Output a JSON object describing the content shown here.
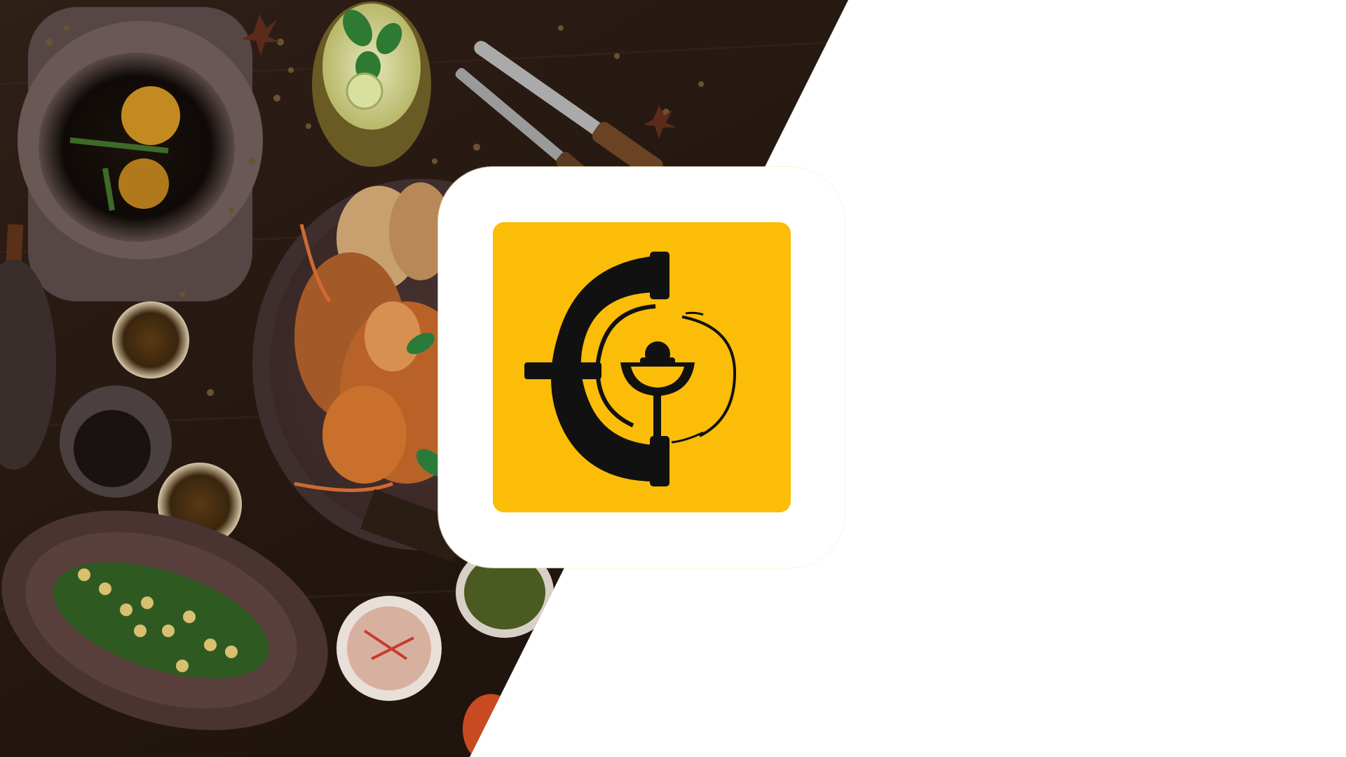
{
  "background": {
    "photo_subject": "food-spread-on-wooden-table",
    "left_color": "#2a1c14",
    "right_color": "#ffffff"
  },
  "app_icon": {
    "card_color": "#ffffff",
    "tile_color": "#fbbd08",
    "mark_color": "#111111",
    "icon_name": "restaurant-logo-icon"
  }
}
